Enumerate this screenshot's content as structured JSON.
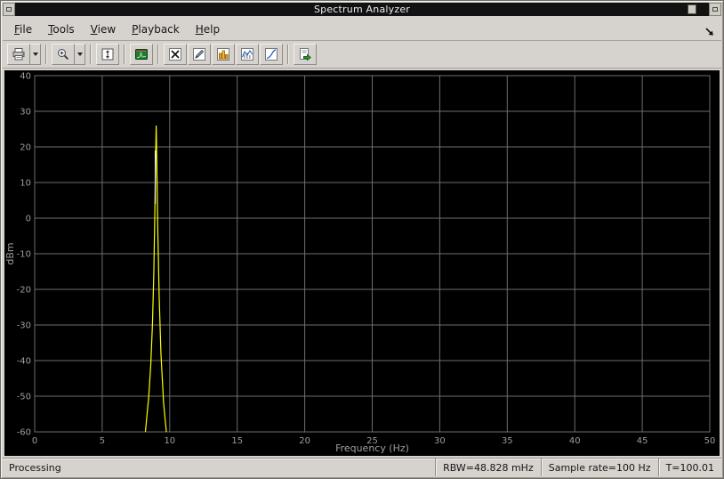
{
  "window": {
    "title": "Spectrum Analyzer"
  },
  "menu": {
    "items": [
      {
        "label": "File"
      },
      {
        "label": "Tools"
      },
      {
        "label": "View"
      },
      {
        "label": "Playback"
      },
      {
        "label": "Help"
      }
    ]
  },
  "toolbar": {
    "buttons": [
      {
        "name": "print",
        "icon": "printer-icon",
        "has_dropdown": true
      },
      {
        "name": "zoom",
        "icon": "magnifier-icon",
        "has_dropdown": true
      },
      {
        "name": "fit-to-view",
        "icon": "fit-view-arrows-icon"
      },
      {
        "name": "spectrum-settings",
        "icon": "green-scope-icon"
      },
      {
        "name": "cursor-measurements",
        "icon": "cursor-x-icon"
      },
      {
        "name": "peak-finder",
        "icon": "pencil-icon"
      },
      {
        "name": "channel-measurements",
        "icon": "orange-bars-icon"
      },
      {
        "name": "distortion-measurements",
        "icon": "wave-chart-icon"
      },
      {
        "name": "ccdf-measurements",
        "icon": "diagonal-curve-icon"
      },
      {
        "name": "export",
        "icon": "page-green-arrow-icon"
      }
    ]
  },
  "status": {
    "message": "Processing",
    "rbw": "RBW=48.828 mHz",
    "sample_rate": "Sample rate=100 Hz",
    "time": "T=100.01"
  },
  "chart_data": {
    "type": "line",
    "title": "",
    "xlabel": "Frequency (Hz)",
    "ylabel": "dBm",
    "xlim": [
      0,
      50
    ],
    "ylim": [
      -60,
      40
    ],
    "xticks": [
      0,
      5,
      10,
      15,
      20,
      25,
      30,
      35,
      40,
      45,
      50
    ],
    "yticks": [
      40,
      30,
      20,
      10,
      0,
      -10,
      -20,
      -30,
      -40,
      -50,
      -60
    ],
    "grid": true,
    "background": "#000000",
    "grid_color": "#6e6e6e",
    "tick_color": "#9e9e9e",
    "series": [
      {
        "name": "spectrum-trace",
        "color": "#ffff00",
        "x": [
          8.2,
          8.45,
          8.6,
          8.72,
          8.82,
          8.9,
          8.96,
          9.0,
          9.05,
          9.12,
          9.22,
          9.35,
          9.55,
          9.75
        ],
        "y": [
          -60,
          -50,
          -41,
          -30,
          -16,
          2,
          18,
          26,
          14,
          -4,
          -22,
          -38,
          -52,
          -60
        ]
      },
      {
        "name": "live-trace-tip",
        "color": "#f2f2f2",
        "x": [
          8.93,
          8.93
        ],
        "y": [
          19,
          4
        ]
      }
    ]
  }
}
